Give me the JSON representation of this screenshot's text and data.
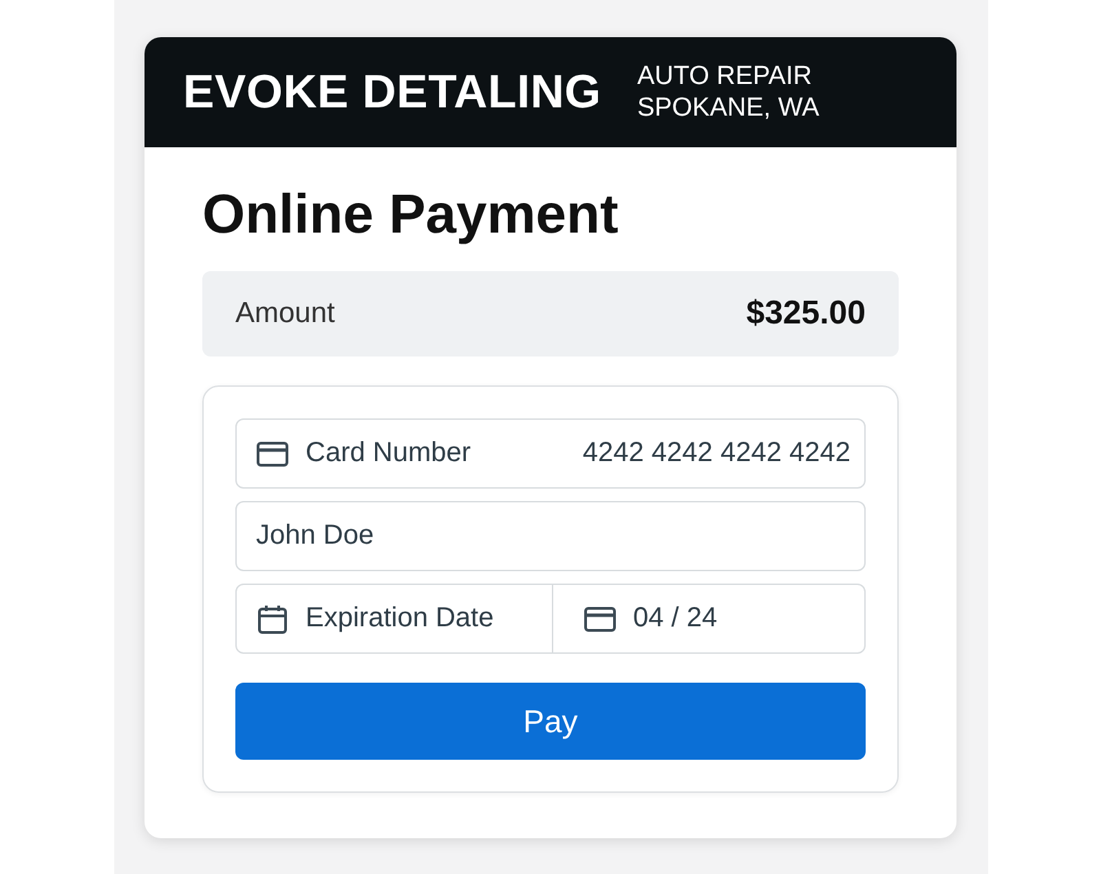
{
  "header": {
    "business_name": "EVOKE DETALING",
    "tagline_lines": [
      "AUTO REPAIR",
      "SPOKANE, WA"
    ]
  },
  "title": "Online Payment",
  "amount": {
    "label": "Amount",
    "value": "$325.00"
  },
  "form": {
    "card_number": {
      "label": "Card Number",
      "value": "4242 4242 4242 4242"
    },
    "name": {
      "value": "John Doe"
    },
    "expiration": {
      "label": "Expiration Date",
      "value": "04 / 24"
    },
    "button": "Pay"
  }
}
